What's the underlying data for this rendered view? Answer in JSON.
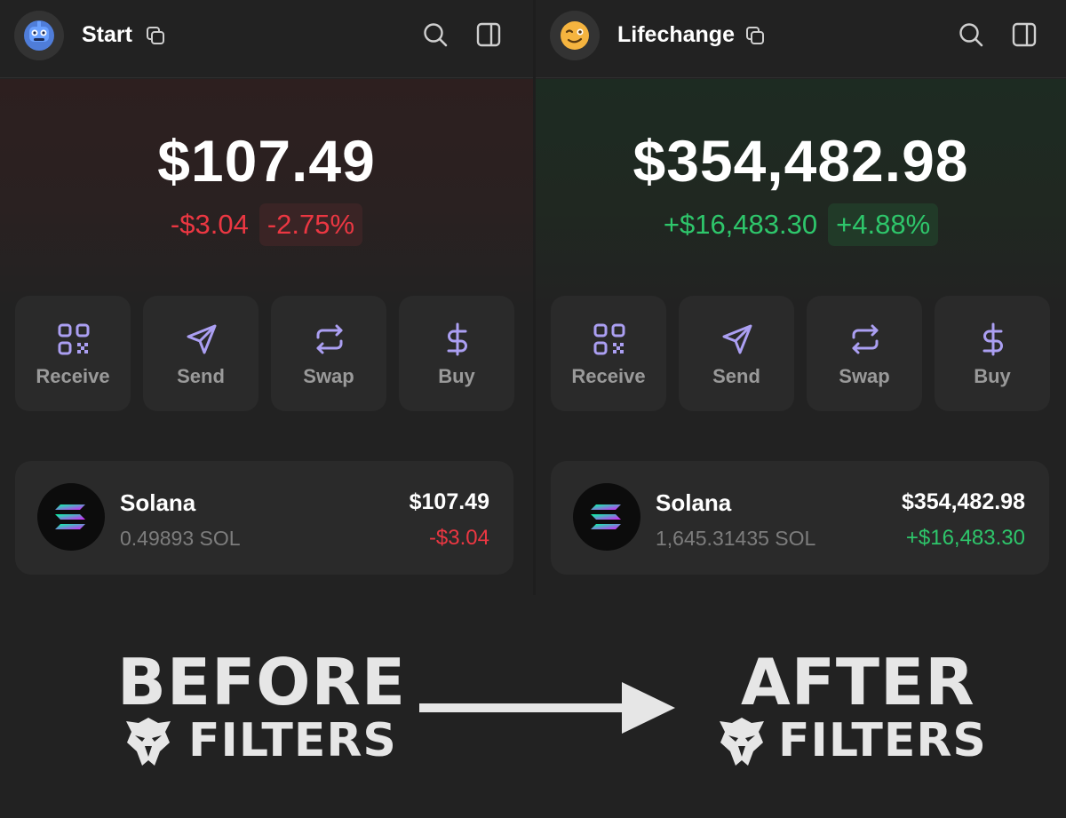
{
  "left": {
    "account_name": "Start",
    "balance": "$107.49",
    "change": "-$3.04",
    "change_pct": "-2.75%",
    "actions": [
      {
        "label": "Receive",
        "icon": "qr-code-icon"
      },
      {
        "label": "Send",
        "icon": "send-icon"
      },
      {
        "label": "Swap",
        "icon": "swap-icon"
      },
      {
        "label": "Buy",
        "icon": "dollar-icon"
      }
    ],
    "token": {
      "name": "Solana",
      "amount": "0.49893 SOL",
      "value": "$107.49",
      "change": "-$3.04"
    }
  },
  "right": {
    "account_name": "Lifechange",
    "balance": "$354,482.98",
    "change": "+$16,483.30",
    "change_pct": "+4.88%",
    "actions": [
      {
        "label": "Receive",
        "icon": "qr-code-icon"
      },
      {
        "label": "Send",
        "icon": "send-icon"
      },
      {
        "label": "Swap",
        "icon": "swap-icon"
      },
      {
        "label": "Buy",
        "icon": "dollar-icon"
      }
    ],
    "token": {
      "name": "Solana",
      "amount": "1,645.31435 SOL",
      "value": "$354,482.98",
      "change": "+$16,483.30"
    }
  },
  "banner": {
    "before": "BEFORE",
    "after": "AFTER",
    "filters_left": "FILTERS",
    "filters_right": "FILTERS"
  },
  "colors": {
    "negative": "#eb3742",
    "positive": "#2ec66b",
    "accent_icon": "#ab9ff2"
  }
}
